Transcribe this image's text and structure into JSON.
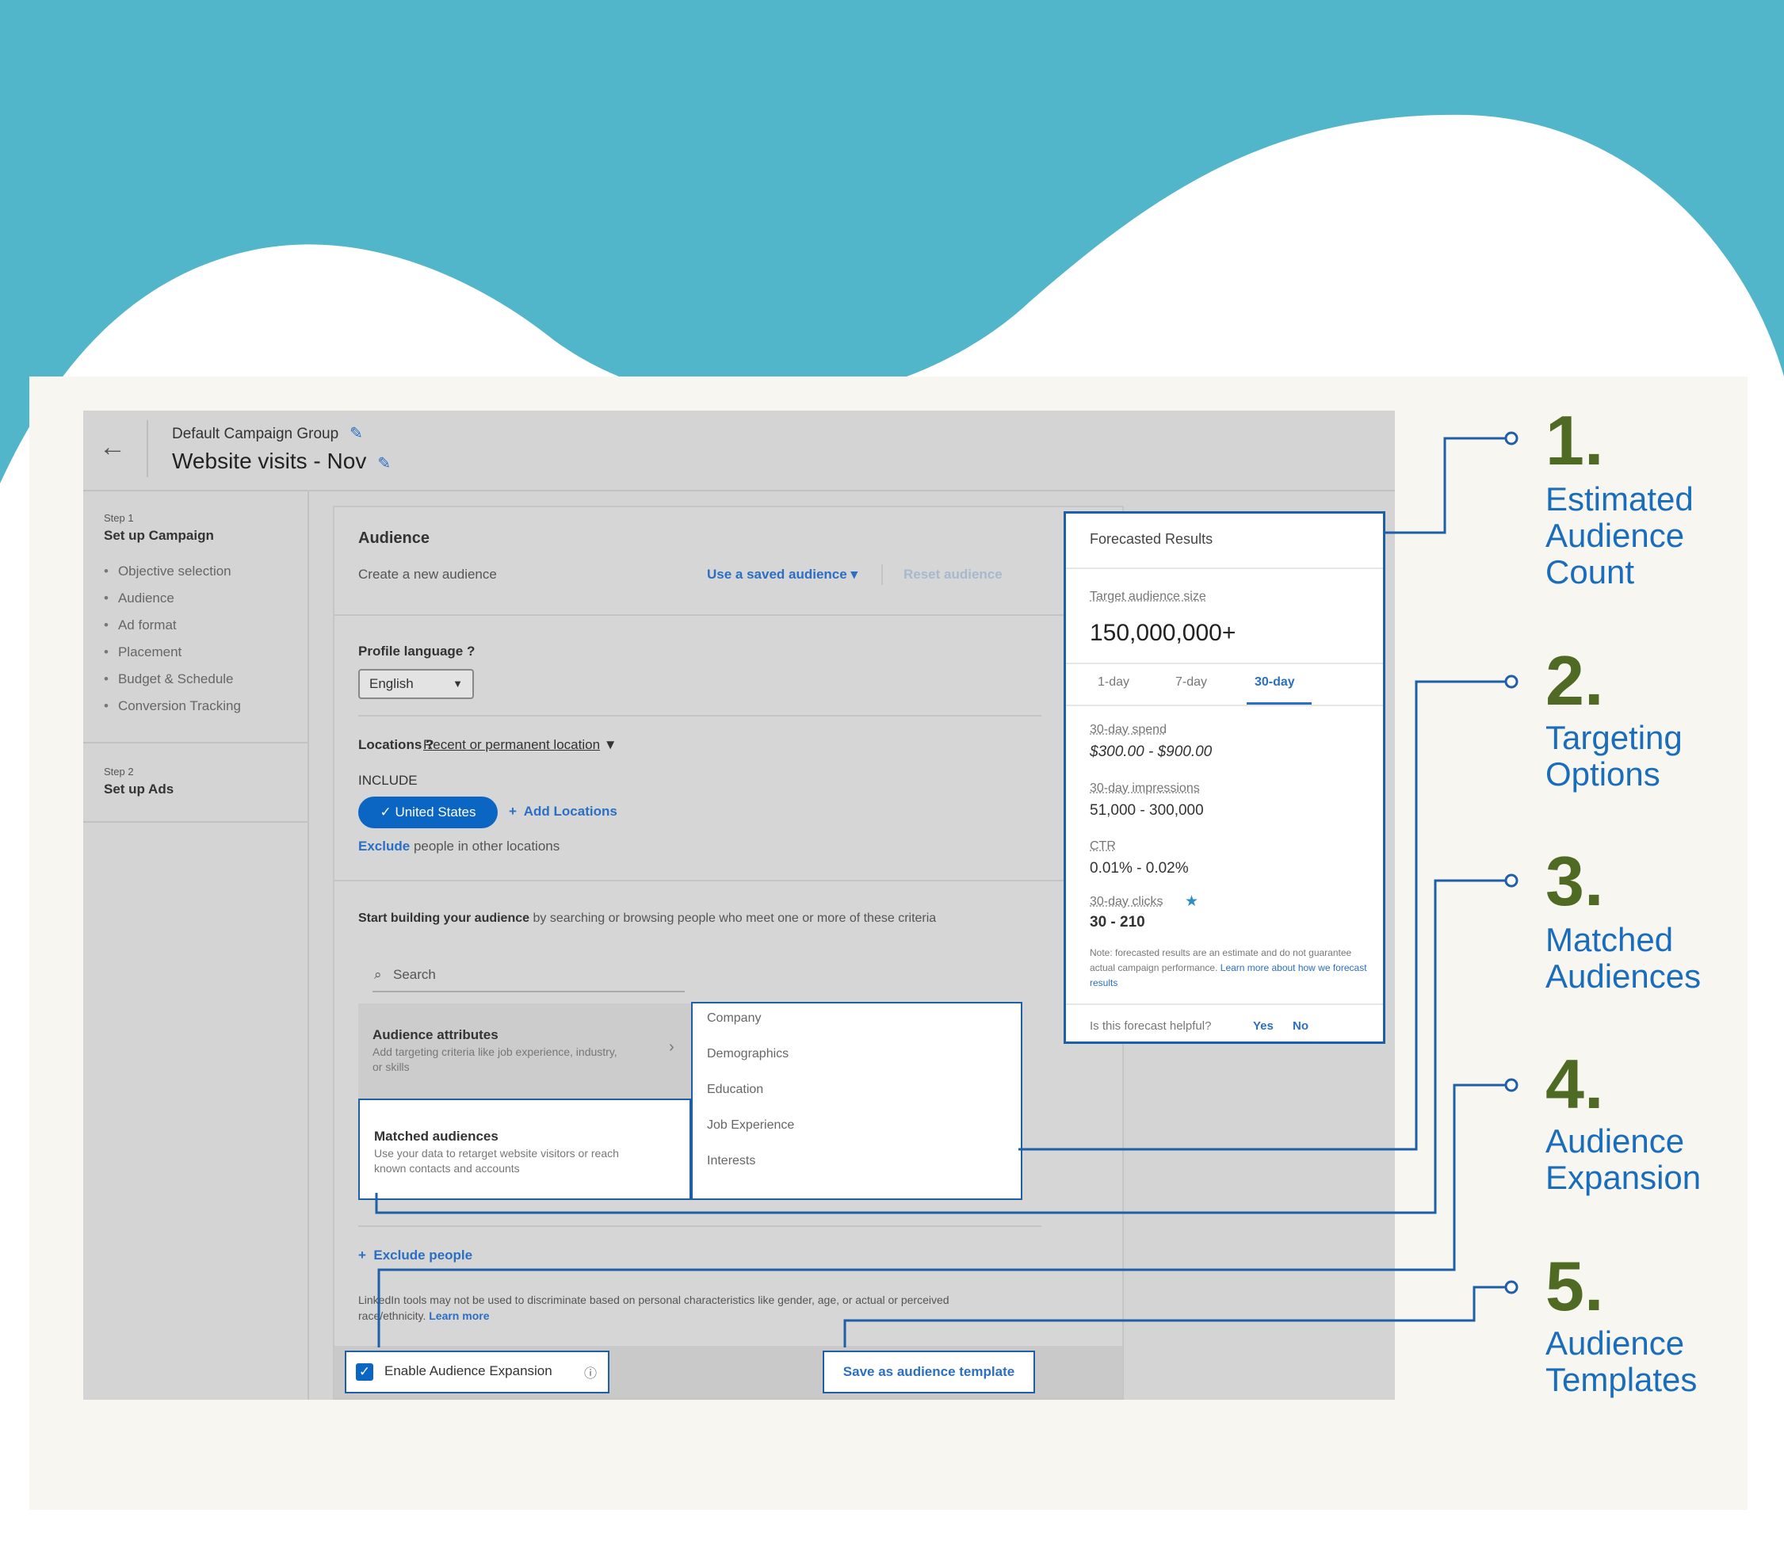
{
  "header": {
    "back_icon": "arrow-left-icon",
    "group": "Default Campaign Group",
    "campaign": "Website visits - Nov"
  },
  "sidebar": {
    "step1_label": "Step 1",
    "step1_title": "Set up Campaign",
    "items": [
      "Objective selection",
      "Audience",
      "Ad format",
      "Placement",
      "Budget & Schedule",
      "Conversion Tracking"
    ],
    "step2_label": "Step 2",
    "step2_title": "Set up Ads"
  },
  "audience": {
    "title": "Audience",
    "create": "Create a new audience",
    "use_saved": "Use a saved audience",
    "reset": "Reset audience",
    "profile_language_label": "Profile language",
    "profile_language_value": "English",
    "locations_label": "Locations",
    "locations_type": "Recent or permanent location",
    "include_label": "INCLUDE",
    "location_chip": "✓ United States",
    "add_locations": "Add Locations",
    "exclude_link": "Exclude",
    "exclude_rest": "people in other locations",
    "build_bold": "Start building your audience",
    "build_rest": "by searching or browsing people who meet one or more of these criteria",
    "search_placeholder": "Search",
    "attributes_title": "Audience attributes",
    "attributes_desc": "Add targeting criteria like job experience, industry, or skills",
    "matched_title": "Matched audiences",
    "matched_desc": "Use your data to retarget website visitors or reach known contacts and accounts",
    "categories": [
      "Company",
      "Demographics",
      "Education",
      "Job Experience",
      "Interests"
    ],
    "exclude_people": "Exclude people",
    "disclaimer": "LinkedIn tools may not be used to discriminate based on personal characteristics like gender, age, or actual or perceived race/ethnicity.",
    "learn_more": "Learn more",
    "enable_expansion": "Enable Audience Expansion",
    "save_template": "Save as audience template"
  },
  "forecast": {
    "title": "Forecasted Results",
    "target_label": "Target audience size",
    "target_value": "150,000,000+",
    "tabs": [
      "1-day",
      "7-day",
      "30-day"
    ],
    "active_tab": "30-day",
    "spend_label": "30-day spend",
    "spend_value": "$300.00 - $900.00",
    "impr_label": "30-day impressions",
    "impr_value": "51,000 - 300,000",
    "ctr_label": "CTR",
    "ctr_value": "0.01% - 0.02%",
    "clicks_label": "30-day clicks",
    "clicks_value": "30 - 210",
    "note": "Note: forecasted results are an estimate and do not guarantee actual campaign performance.",
    "note_link": "Learn more about how we forecast results",
    "helpful": "Is this forecast helpful?",
    "yes": "Yes",
    "no": "No"
  },
  "callouts": [
    {
      "num": "1.",
      "line1": "Estimated",
      "line2": "Audience",
      "line3": "Count"
    },
    {
      "num": "2.",
      "line1": "Targeting",
      "line2": "Options"
    },
    {
      "num": "3.",
      "line1": "Matched",
      "line2": "Audiences"
    },
    {
      "num": "4.",
      "line1": "Audience",
      "line2": "Expansion"
    },
    {
      "num": "5.",
      "line1": "Audience",
      "line2": "Templates"
    }
  ],
  "colors": {
    "teal": "#51b6c9",
    "callout_number": "#4f6b23",
    "callout_text": "#1a6dbb",
    "linkedin_blue": "#0a66c2"
  }
}
